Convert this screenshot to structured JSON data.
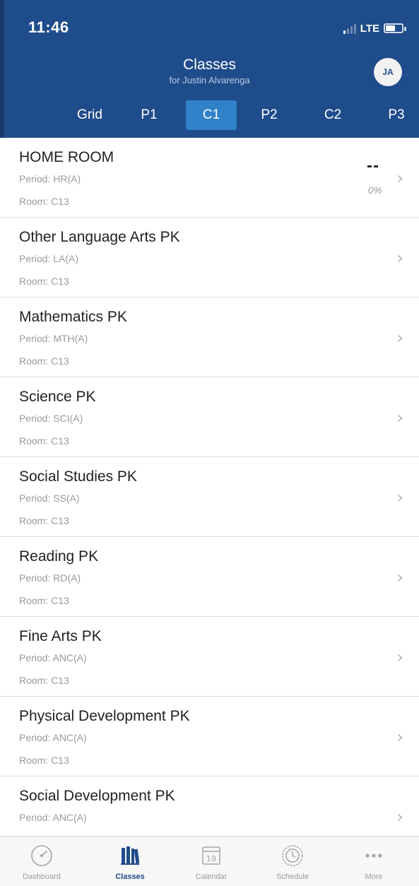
{
  "status_bar": {
    "time": "11:46",
    "network": "LTE",
    "battery_level": 0.55,
    "signal_bars_on": 1,
    "signal_bars_total": 4
  },
  "header": {
    "title": "Classes",
    "subtitle": "for Justin Alvarenga",
    "avatar_initials": "JA"
  },
  "tabs": [
    {
      "label": "Grid",
      "active": false
    },
    {
      "label": "P1",
      "active": false
    },
    {
      "label": "C1",
      "active": true
    },
    {
      "label": "P2",
      "active": false
    },
    {
      "label": "C2",
      "active": false
    },
    {
      "label": "P3",
      "active": false
    }
  ],
  "classes": [
    {
      "name": "HOME ROOM",
      "period": "Period: HR(A)",
      "room": "Room: C13",
      "grade": "--",
      "percent": "0%"
    },
    {
      "name": "Other Language Arts PK",
      "period": "Period: LA(A)",
      "room": "Room: C13"
    },
    {
      "name": "Mathematics PK",
      "period": "Period: MTH(A)",
      "room": "Room: C13"
    },
    {
      "name": "Science PK",
      "period": "Period: SCI(A)",
      "room": "Room: C13"
    },
    {
      "name": "Social Studies PK",
      "period": "Period: SS(A)",
      "room": "Room: C13"
    },
    {
      "name": "Reading PK",
      "period": "Period: RD(A)",
      "room": "Room: C13"
    },
    {
      "name": "Fine Arts PK",
      "period": "Period: ANC(A)",
      "room": "Room: C13"
    },
    {
      "name": "Physical Development PK",
      "period": "Period: ANC(A)",
      "room": "Room: C13"
    },
    {
      "name": "Social Development PK",
      "period": "Period: ANC(A)",
      "room": ""
    }
  ],
  "tabbar": [
    {
      "label": "Dashboard",
      "icon": "gauge-icon",
      "active": false
    },
    {
      "label": "Classes",
      "icon": "books-icon",
      "active": true
    },
    {
      "label": "Calendar",
      "icon": "calendar-icon",
      "active": false,
      "icon_text": "19"
    },
    {
      "label": "Schedule",
      "icon": "clock-icon",
      "active": false
    },
    {
      "label": "More",
      "icon": "more-dots-icon",
      "active": false
    }
  ],
  "colors": {
    "header": "#1f4c8a",
    "active_tab": "#2f82c8",
    "active_tabbar": "#1f4c8a",
    "inactive": "#9a9a9a"
  }
}
